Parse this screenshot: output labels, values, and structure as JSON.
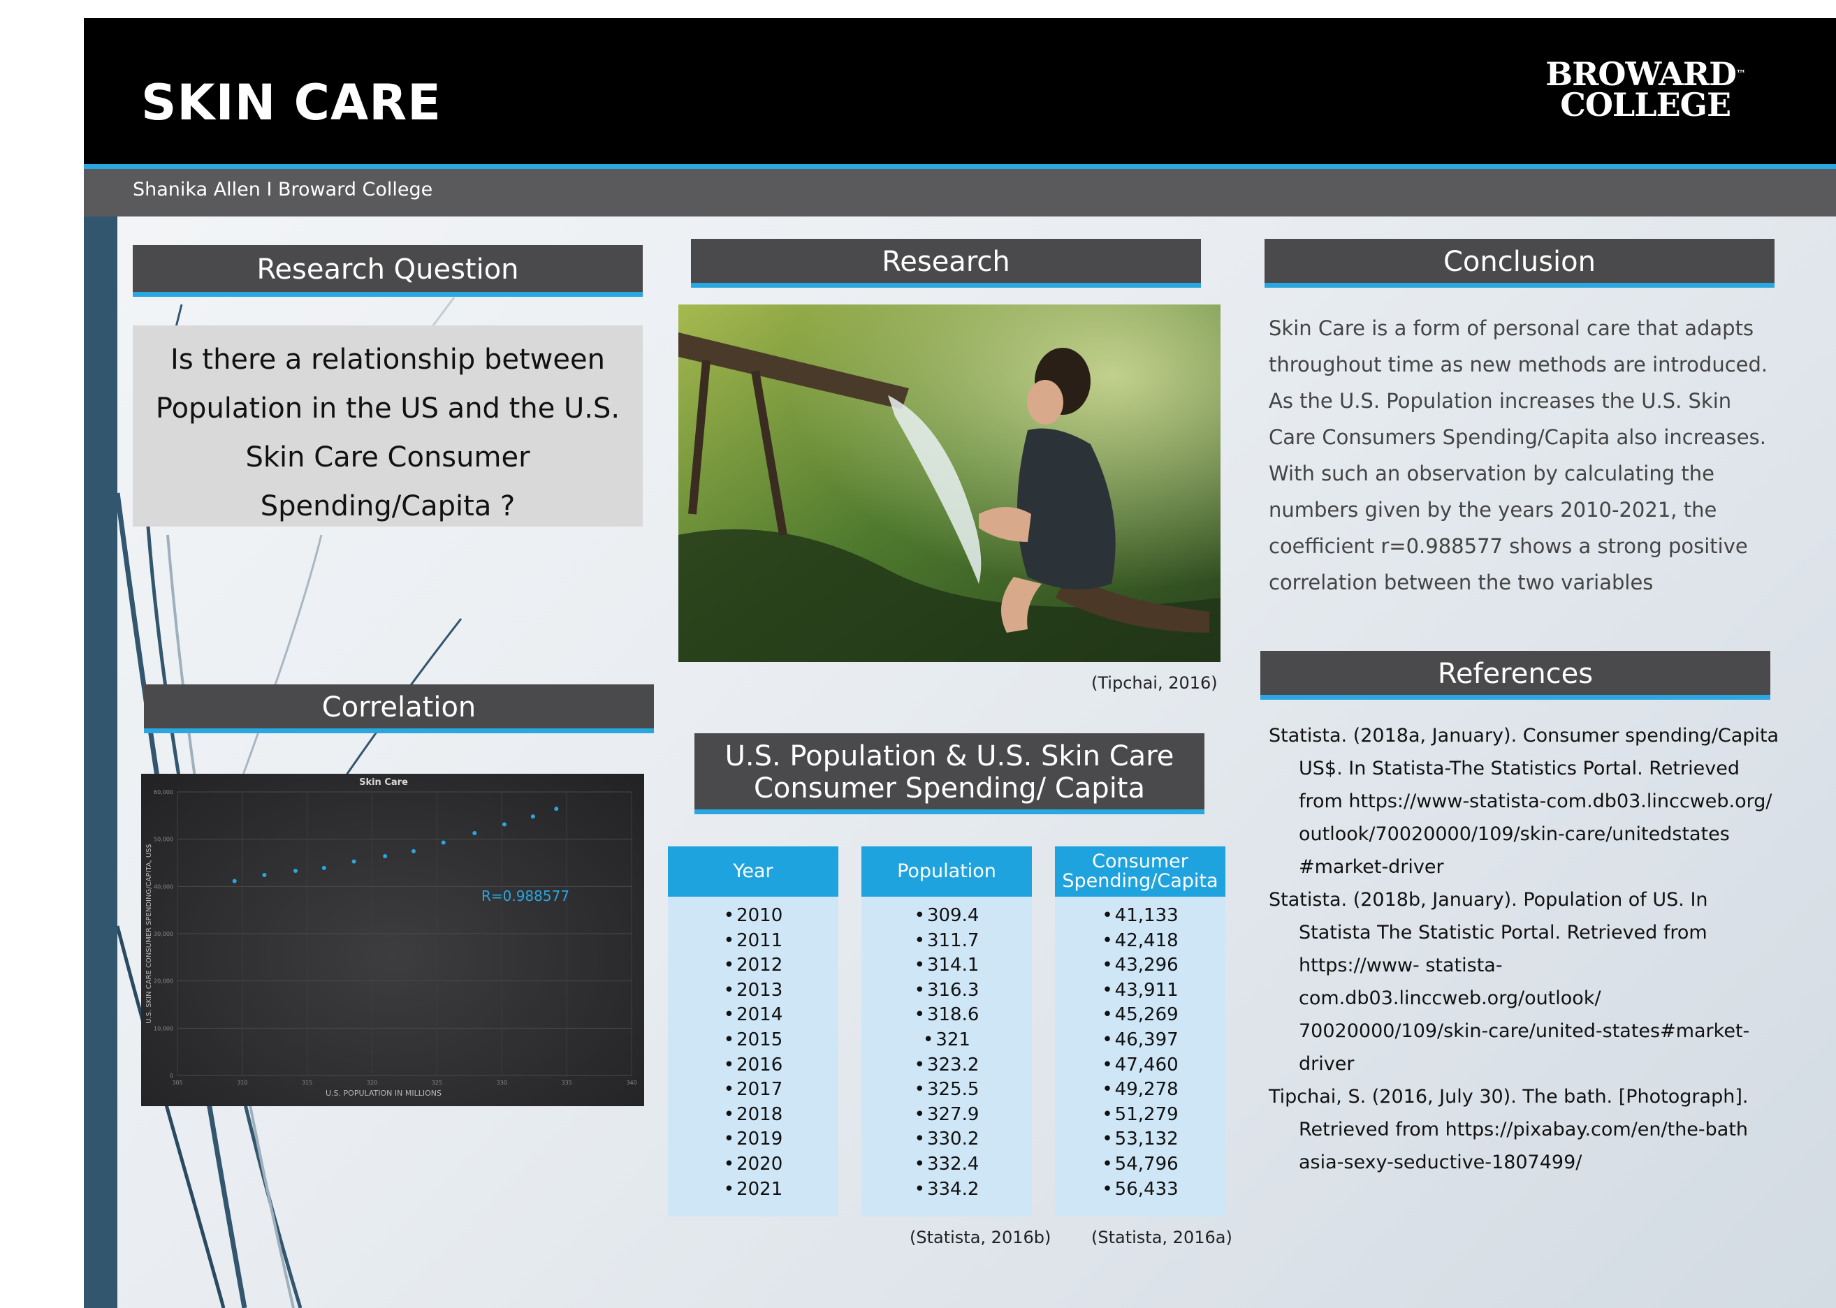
{
  "header": {
    "title": "SKIN CARE",
    "logo_line1": "BROWARD",
    "logo_line2": "COLLEGE",
    "logo_tm": "™",
    "author": "Shanika Allen I Broward College"
  },
  "research_question": {
    "heading": "Research Question",
    "text": "Is there a relationship between Population in the US and the U.S. Skin Care Consumer Spending/Capita ?"
  },
  "research": {
    "heading": "Research",
    "photo_credit": "(Tipchai, 2016)"
  },
  "conclusion": {
    "heading": "Conclusion",
    "text": "Skin Care is a form of personal care that adapts throughout time as new methods are introduced. As the U.S. Population increases the U.S. Skin Care Consumers Spending/Capita also increases. With such an observation by calculating the numbers given by the years 2010-2021, the coefficient r=0.988577 shows a strong positive correlation between the two variables"
  },
  "references": {
    "heading": "References",
    "items": [
      "Statista. (2018a, January). Consumer spending/Capita US$. In Statista-The Statistics Portal. Retrieved from https://www-statista-com.db03.linccweb.org/ outlook/70020000/109/skin-care/unitedstates #market-driver",
      "Statista. (2018b, January). Population of US. In Statista The Statistic Portal. Retrieved from https://www- statista- com.db03.linccweb.org/outlook/ 70020000/109/skin-care/united-states#market-driver",
      "Tipchai, S. (2016, July 30). The bath. [Photograph]. Retrieved from https://pixabay.com/en/the-bath asia-sexy-seductive-1807499/"
    ]
  },
  "correlation": {
    "heading": "Correlation"
  },
  "table_section": {
    "heading_line1": "U.S. Population & U.S. Skin Care",
    "heading_line2": "Consumer Spending/ Capita",
    "columns": [
      "Year",
      "Population",
      "Consumer Spending/Capita"
    ],
    "years": [
      "2010",
      "2011",
      "2012",
      "2013",
      "2014",
      "2015",
      "2016",
      "2017",
      "2018",
      "2019",
      "2020",
      "2021"
    ],
    "population": [
      "309.4",
      "311.7",
      "314.1",
      "316.3",
      "318.6",
      "321",
      "323.2",
      "325.5",
      "327.9",
      "330.2",
      "332.4",
      "334.2"
    ],
    "spending": [
      "41,133",
      "42,418",
      "43,296",
      "43,911",
      "45,269",
      "46,397",
      "47,460",
      "49,278",
      "51,279",
      "53,132",
      "54,796",
      "56,433"
    ],
    "credit_population": "(Statista, 2016b)",
    "credit_spending": "(Statista, 2016a)"
  },
  "chart_data": {
    "type": "scatter",
    "title": "Skin Care",
    "xlabel": "U.S. POPULATION IN MILLIONS",
    "ylabel": "U.S. SKIN CARE CONSUMER SPENDING/CAPITA, US$",
    "annotation": "R=0.988577",
    "xlim": [
      305,
      340
    ],
    "ylim": [
      0,
      60000
    ],
    "x_ticks": [
      "305",
      "310",
      "315",
      "320",
      "325",
      "330",
      "335",
      "340"
    ],
    "y_ticks": [
      "0",
      "10,000",
      "20,000",
      "30,000",
      "40,000",
      "50,000",
      "60,000"
    ],
    "grid": true,
    "point_color": "#2aa6e0",
    "x": [
      309.4,
      311.7,
      314.1,
      316.3,
      318.6,
      321,
      323.2,
      325.5,
      327.9,
      330.2,
      332.4,
      334.2
    ],
    "y": [
      41133,
      42418,
      43296,
      43911,
      45269,
      46397,
      47460,
      49278,
      51279,
      53132,
      54796,
      56433
    ]
  },
  "colors": {
    "accent": "#2aa6e0",
    "header_bg": "#000000",
    "section_header_bg": "#4a4a4c",
    "table_header_bg": "#1fa3de",
    "table_body_bg": "#cfe6f6",
    "sidebar": "#33566f"
  }
}
